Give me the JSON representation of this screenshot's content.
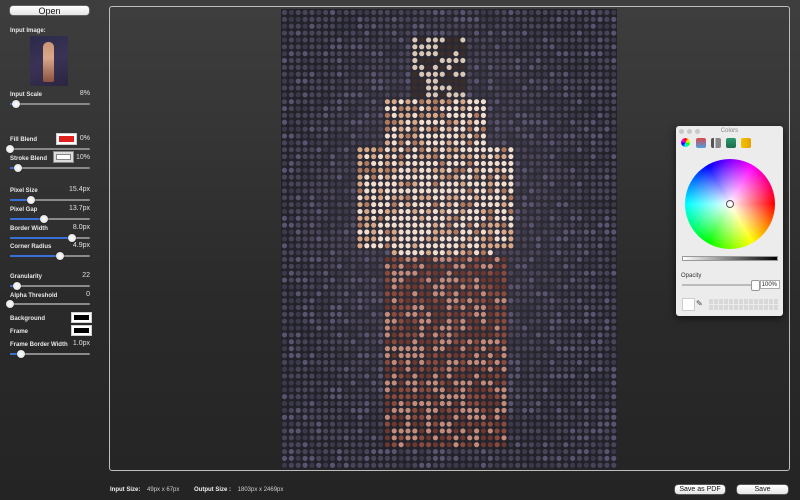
{
  "toolbar": {
    "open_label": "Open"
  },
  "sidebar": {
    "input_image_label": "Input Image:",
    "controls": {
      "input_scale": {
        "label": "Input Scale",
        "value": "8%",
        "level": 0.08
      },
      "fill_blend": {
        "label": "Fill Blend",
        "value": "0%",
        "level": 0.0,
        "color": "#e0201c"
      },
      "stroke_blend": {
        "label": "Stroke Blend",
        "value": "10%",
        "level": 0.1,
        "color": "#ffffff"
      },
      "pixel_size": {
        "label": "Pixel Size",
        "value": "15.4px",
        "level": 0.26
      },
      "pixel_gap": {
        "label": "Pixel Gap",
        "value": "13.7px",
        "level": 0.43
      },
      "border_width": {
        "label": "Border Width",
        "value": "8.0px",
        "level": 0.77
      },
      "corner_radius": {
        "label": "Corner Radius",
        "value": "4.9px",
        "level": 0.63
      },
      "granularity": {
        "label": "Granularity",
        "value": "22",
        "level": 0.09
      },
      "alpha_threshold": {
        "label": "Alpha Threshold",
        "value": "0",
        "level": 0.0
      },
      "frame_border_width": {
        "label": "Frame Border Width",
        "value": "1.0px",
        "level": 0.14
      }
    },
    "background_label": "Background",
    "frame_label": "Frame",
    "background_color": "#000000",
    "frame_color": "#000000"
  },
  "footer": {
    "input_size_label": "Input Size:",
    "input_size_value": "49px x 67px",
    "output_size_label": "Output Size :",
    "output_size_value": "1803px x 2469px",
    "save_pdf_label": "Save as PDF",
    "save_label": "Save"
  },
  "colors_panel": {
    "title": "Colors",
    "opacity_label": "Opacity",
    "opacity_value": "100%"
  },
  "colors": {
    "accent": "#3a6fd8"
  }
}
